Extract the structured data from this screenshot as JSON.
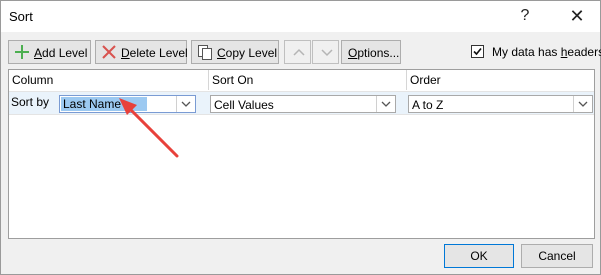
{
  "title": "Sort",
  "titlebar": {
    "help_glyph": "?",
    "close_glyph": "✕"
  },
  "toolbar": {
    "add_level": {
      "pre": "",
      "accel": "A",
      "post": "dd Level",
      "icon": "plus-icon"
    },
    "delete_level": {
      "pre": "",
      "accel": "D",
      "post": "elete Level",
      "icon": "x-icon"
    },
    "copy_level": {
      "pre": "",
      "accel": "C",
      "post": "opy Level",
      "icon": "copy-icon"
    },
    "move_up_icon": "chevron-up-icon",
    "move_down_icon": "chevron-down-icon",
    "options": {
      "pre": "",
      "accel": "O",
      "post": "ptions..."
    }
  },
  "headers_checkbox": {
    "pre": "My data has ",
    "accel": "h",
    "post": "eaders",
    "checked": true
  },
  "columns": {
    "column": "Column",
    "sort_on": "Sort On",
    "order": "Order"
  },
  "level_row": {
    "label": "Sort by",
    "column_value": "Last Name",
    "sort_on_value": "Cell Values",
    "order_value": "A to Z"
  },
  "buttons": {
    "ok": "OK",
    "cancel": "Cancel"
  },
  "colors": {
    "accent": "#0078d7",
    "selection": "#9cc9f1",
    "arrow": "#e8413b",
    "add_icon": "#4caf50",
    "delete_icon": "#d9534f"
  }
}
